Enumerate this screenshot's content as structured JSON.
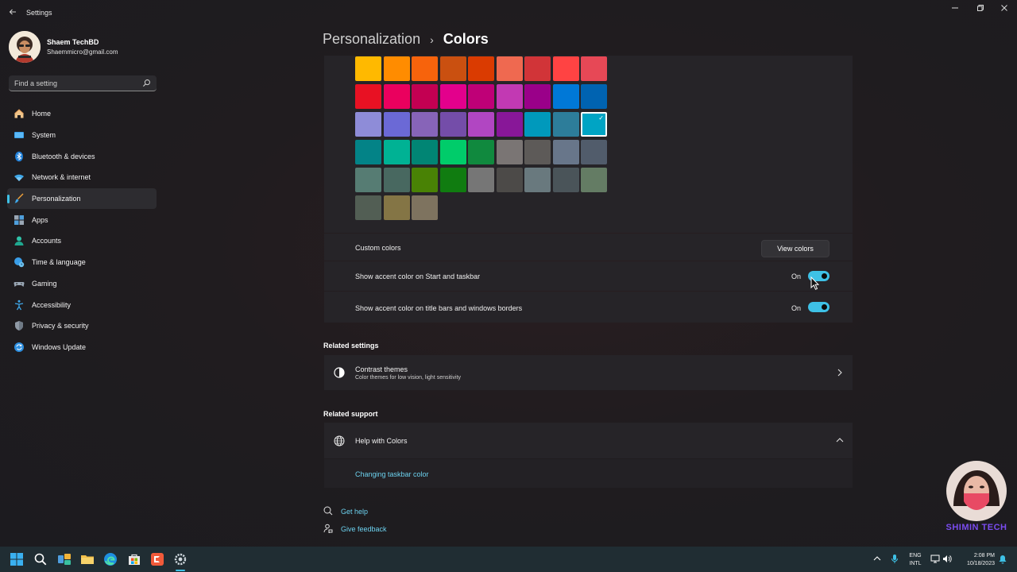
{
  "window": {
    "title": "Settings"
  },
  "profile": {
    "name": "Shaem TechBD",
    "email": "Shaemmicro@gmail.com"
  },
  "search": {
    "placeholder": "Find a setting"
  },
  "nav": {
    "items": [
      {
        "label": "Home",
        "icon": "home-icon"
      },
      {
        "label": "System",
        "icon": "monitor-icon"
      },
      {
        "label": "Bluetooth & devices",
        "icon": "bluetooth-icon"
      },
      {
        "label": "Network & internet",
        "icon": "wifi-icon"
      },
      {
        "label": "Personalization",
        "icon": "brush-icon",
        "active": true
      },
      {
        "label": "Apps",
        "icon": "apps-icon"
      },
      {
        "label": "Accounts",
        "icon": "person-icon"
      },
      {
        "label": "Time & language",
        "icon": "globe-clock-icon"
      },
      {
        "label": "Gaming",
        "icon": "gamepad-icon"
      },
      {
        "label": "Accessibility",
        "icon": "accessibility-icon"
      },
      {
        "label": "Privacy & security",
        "icon": "shield-icon"
      },
      {
        "label": "Windows Update",
        "icon": "update-icon"
      }
    ]
  },
  "header": {
    "parent": "Personalization",
    "separator": "›",
    "current": "Colors"
  },
  "palette": {
    "selected_color": "#00a4c4",
    "rows": [
      [
        "#ffb900",
        "#ff8c00",
        "#f7630c",
        "#ca5010",
        "#da3b01",
        "#ef6950",
        "#d13438",
        "#ff4343",
        "#e74856"
      ],
      [
        "#e81123",
        "#ea005e",
        "#c30052",
        "#e3008c",
        "#bf0077",
        "#c239b3",
        "#9a0089",
        "#0078d7",
        "#0063b1"
      ],
      [
        "#8e8cd8",
        "#6b69d6",
        "#8764b8",
        "#744da9",
        "#b146c2",
        "#881798",
        "#0099bc",
        "#2d7d9a",
        "#00a4c4"
      ],
      [
        "#038387",
        "#00b294",
        "#018574",
        "#00cc6a",
        "#10893e",
        "#7a7574",
        "#5d5a58",
        "#68768a",
        "#515c6b"
      ],
      [
        "#567c73",
        "#486860",
        "#498205",
        "#107c10",
        "#767676",
        "#4c4a48",
        "#69797e",
        "#4a5459",
        "#647c64"
      ],
      [
        "#525e54",
        "#847545",
        "#7e735f"
      ]
    ]
  },
  "custom_colors": {
    "label": "Custom colors",
    "button": "View colors"
  },
  "start_taskbar_toggle": {
    "label": "Show accent color on Start and taskbar",
    "state": "On",
    "on": true
  },
  "title_bars_toggle": {
    "label": "Show accent color on title bars and windows borders",
    "state": "On",
    "on": true
  },
  "related_settings": {
    "title": "Related settings",
    "contrast": {
      "title": "Contrast themes",
      "description": "Color themes for low vision, light sensitivity"
    }
  },
  "related_support": {
    "title": "Related support",
    "help": {
      "title": "Help with Colors",
      "link": "Changing taskbar color"
    }
  },
  "footer": {
    "get_help": "Get help",
    "feedback": "Give feedback"
  },
  "taskbar": {
    "lang_top": "ENG",
    "lang_bottom": "INTL",
    "time": "2:08 PM",
    "date": "10/18/2023"
  },
  "watermark": {
    "text": "SHIMIN TECH"
  },
  "colors": {
    "accent": "#3ec1e6",
    "link": "#6cd2ef"
  }
}
